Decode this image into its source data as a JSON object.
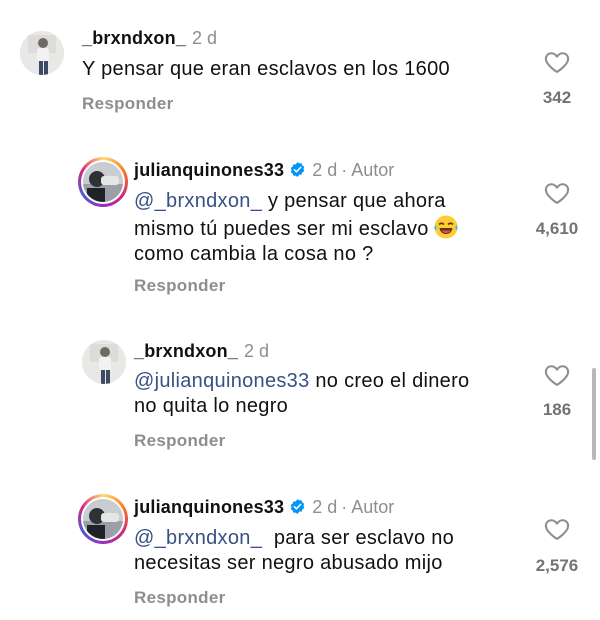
{
  "comments": [
    {
      "username": "_brxndxon_",
      "time": "2 d",
      "author_label": "",
      "verified": false,
      "mention": "",
      "text_line1": "Y pensar que eran esclavos en los 1600",
      "text_line2": "",
      "text_line3": "",
      "reply_label": "Responder",
      "like_count": "342",
      "avatar_icon": "profile-photo-standing-person"
    },
    {
      "username": "julianquinones33",
      "time": "2 d",
      "author_label": "Autor",
      "verified": true,
      "mention": "@_brxndxon_",
      "text_line1": " y pensar que ahora",
      "text_line2": "mismo tú puedes ser mi esclavo",
      "emoji": "😂",
      "text_line3": "como cambia la cosa no ?",
      "reply_label": "Responder",
      "like_count": "4,610",
      "avatar_icon": "profile-photo-story-ring"
    },
    {
      "username": "_brxndxon_",
      "time": "2 d",
      "author_label": "",
      "verified": false,
      "mention": "@julianquinones33",
      "text_line1": " no creo el dinero",
      "text_line2": "no quita lo negro",
      "reply_label": "Responder",
      "like_count": "186",
      "avatar_icon": "profile-photo-standing-person"
    },
    {
      "username": "julianquinones33",
      "time": "2 d",
      "author_label": "Autor",
      "verified": true,
      "mention": "@_brxndxon_",
      "text_line1": "  para ser esclavo no",
      "text_line2": "necesitas ser negro abusado mijo",
      "reply_label": "Responder",
      "like_count": "2,576",
      "avatar_icon": "profile-photo-story-ring"
    }
  ],
  "separator": "·",
  "colors": {
    "mention": "#385185",
    "muted": "#8e8e8e",
    "verified": "#0095f6"
  }
}
